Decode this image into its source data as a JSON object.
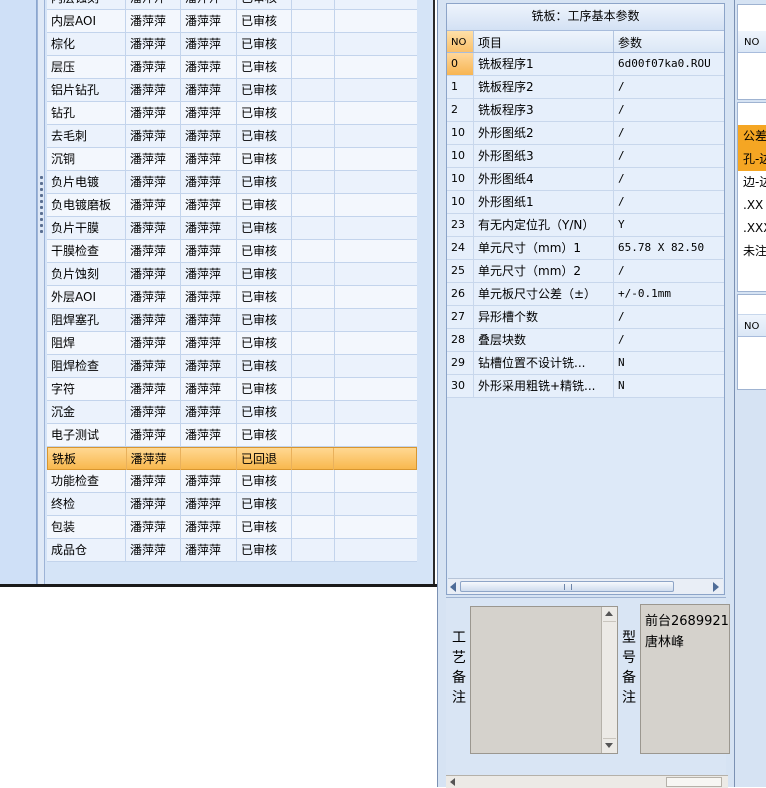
{
  "process_list": {
    "rows": [
      {
        "name": "内层蚀刻",
        "c2": "潘萍萍",
        "c3": "潘萍萍",
        "status": "已审核"
      },
      {
        "name": "内层AOI",
        "c2": "潘萍萍",
        "c3": "潘萍萍",
        "status": "已审核"
      },
      {
        "name": "棕化",
        "c2": "潘萍萍",
        "c3": "潘萍萍",
        "status": "已审核"
      },
      {
        "name": "层压",
        "c2": "潘萍萍",
        "c3": "潘萍萍",
        "status": "已审核"
      },
      {
        "name": "铝片钻孔",
        "c2": "潘萍萍",
        "c3": "潘萍萍",
        "status": "已审核"
      },
      {
        "name": "钻孔",
        "c2": "潘萍萍",
        "c3": "潘萍萍",
        "status": "已审核"
      },
      {
        "name": "去毛刺",
        "c2": "潘萍萍",
        "c3": "潘萍萍",
        "status": "已审核"
      },
      {
        "name": "沉铜",
        "c2": "潘萍萍",
        "c3": "潘萍萍",
        "status": "已审核"
      },
      {
        "name": "负片电镀",
        "c2": "潘萍萍",
        "c3": "潘萍萍",
        "status": "已审核"
      },
      {
        "name": "负电镀磨板",
        "c2": "潘萍萍",
        "c3": "潘萍萍",
        "status": "已审核"
      },
      {
        "name": "负片干膜",
        "c2": "潘萍萍",
        "c3": "潘萍萍",
        "status": "已审核"
      },
      {
        "name": "干膜检查",
        "c2": "潘萍萍",
        "c3": "潘萍萍",
        "status": "已审核"
      },
      {
        "name": "负片蚀刻",
        "c2": "潘萍萍",
        "c3": "潘萍萍",
        "status": "已审核"
      },
      {
        "name": "外层AOI",
        "c2": "潘萍萍",
        "c3": "潘萍萍",
        "status": "已审核"
      },
      {
        "name": "阻焊塞孔",
        "c2": "潘萍萍",
        "c3": "潘萍萍",
        "status": "已审核"
      },
      {
        "name": "阻焊",
        "c2": "潘萍萍",
        "c3": "潘萍萍",
        "status": "已审核"
      },
      {
        "name": "阻焊检查",
        "c2": "潘萍萍",
        "c3": "潘萍萍",
        "status": "已审核"
      },
      {
        "name": "字符",
        "c2": "潘萍萍",
        "c3": "潘萍萍",
        "status": "已审核"
      },
      {
        "name": "沉金",
        "c2": "潘萍萍",
        "c3": "潘萍萍",
        "status": "已审核"
      },
      {
        "name": "电子测试",
        "c2": "潘萍萍",
        "c3": "潘萍萍",
        "status": "已审核"
      },
      {
        "name": "铣板",
        "c2": "潘萍萍",
        "c3": "",
        "status": "已回退"
      },
      {
        "name": "功能检查",
        "c2": "潘萍萍",
        "c3": "潘萍萍",
        "status": "已审核"
      },
      {
        "name": "终检",
        "c2": "潘萍萍",
        "c3": "潘萍萍",
        "status": "已审核"
      },
      {
        "name": "包装",
        "c2": "潘萍萍",
        "c3": "潘萍萍",
        "status": "已审核"
      },
      {
        "name": "成品仓",
        "c2": "潘萍萍",
        "c3": "潘萍萍",
        "status": "已审核"
      }
    ]
  },
  "param_panel": {
    "title": "铣板：工序基本参数",
    "headers": {
      "no": "NO",
      "item": "项目",
      "param": "参数"
    },
    "rows": [
      {
        "no": "0",
        "item": "铣板程序1",
        "param": "6d00f07ka0.ROU"
      },
      {
        "no": "1",
        "item": "铣板程序2",
        "param": "/"
      },
      {
        "no": "2",
        "item": "铣板程序3",
        "param": "/"
      },
      {
        "no": "10",
        "item": "外形图纸2",
        "param": "/"
      },
      {
        "no": "10",
        "item": "外形图纸3",
        "param": "/"
      },
      {
        "no": "10",
        "item": "外形图纸4",
        "param": "/"
      },
      {
        "no": "10",
        "item": "外形图纸1",
        "param": "/"
      },
      {
        "no": "23",
        "item": "有无内定位孔（Y/N）",
        "param": "Y"
      },
      {
        "no": "24",
        "item": "单元尺寸（mm）1",
        "param": "65.78 X 82.50"
      },
      {
        "no": "25",
        "item": "单元尺寸（mm）2",
        "param": "/"
      },
      {
        "no": "26",
        "item": "单元板尺寸公差（±）",
        "param": "+/-0.1mm"
      },
      {
        "no": "27",
        "item": "异形槽个数",
        "param": "/"
      },
      {
        "no": "28",
        "item": "叠层块数",
        "param": "/"
      },
      {
        "no": "29",
        "item": "钻槽位置不设计铣...",
        "param": "N"
      },
      {
        "no": "30",
        "item": "外形采用粗铣+精铣...",
        "param": "N"
      }
    ]
  },
  "remarks": {
    "craft_label": [
      "工",
      "艺",
      "备",
      "注"
    ],
    "craft_text": "",
    "model_label": [
      "型",
      "号",
      "备",
      "注"
    ],
    "model_lines": [
      "前台2689921",
      "唐林峰"
    ]
  },
  "right_pane": {
    "top_header": "NO",
    "tol_lines": [
      "公差",
      "孔-边",
      "边-边",
      ".XX",
      ".XXX",
      "未注"
    ],
    "bottom_header": "NO"
  },
  "colors": {
    "selected_row": "#f8b84e",
    "grid_bg": "#ebf2fc",
    "panel_bg": "#dde9f8",
    "tol_highlight": "#f5a623"
  }
}
